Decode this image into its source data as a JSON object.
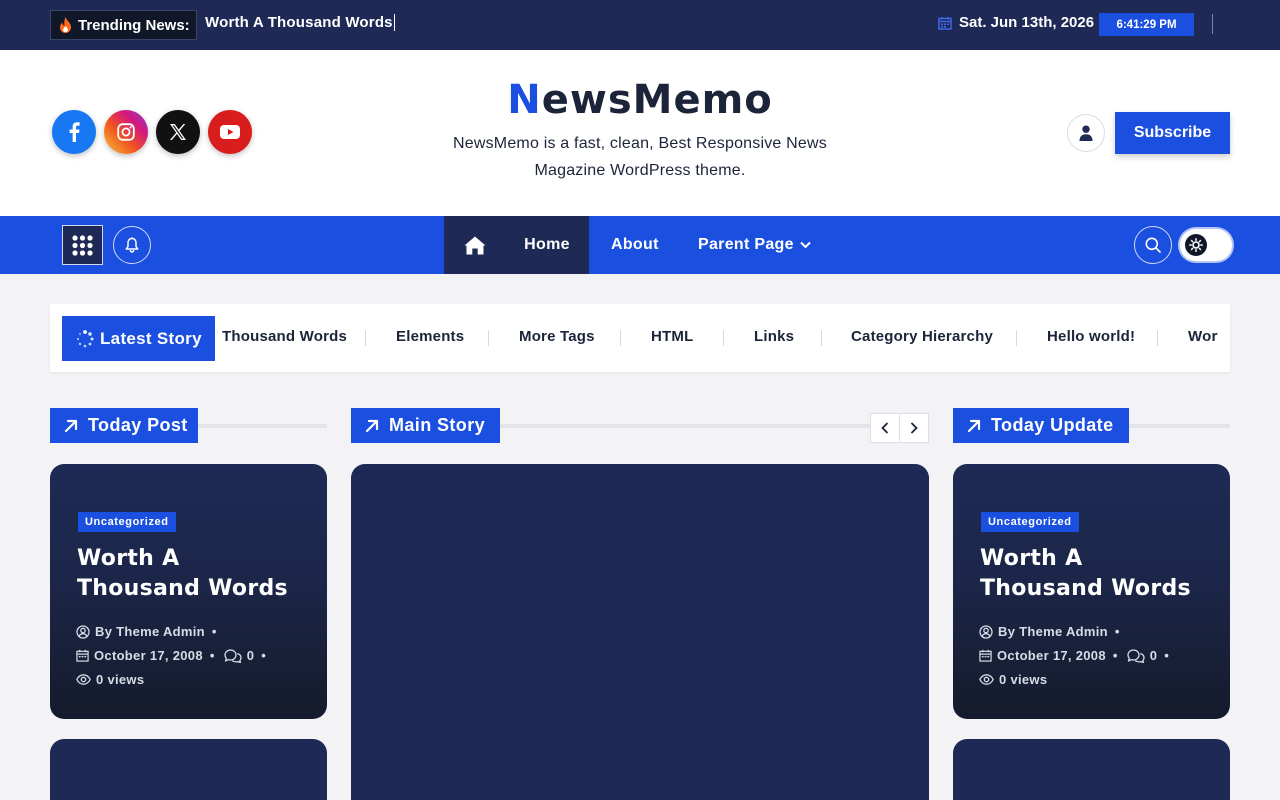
{
  "topbar": {
    "trending_label": "Trending News:",
    "trending_text": "Worth A Thousand Words",
    "date": "Sat. Jun 13th, 2026",
    "time": "6:41:29 PM"
  },
  "header": {
    "logo_first": "N",
    "logo_rest": "ewsMemo",
    "tagline": "NewsMemo is a fast, clean, Best Responsive News Magazine WordPress theme.",
    "subscribe_label": "Subscribe",
    "social": [
      "facebook-icon",
      "instagram-icon",
      "x-icon",
      "youtube-icon"
    ]
  },
  "nav": {
    "items": [
      {
        "label": "Home"
      },
      {
        "label": "About"
      },
      {
        "label": "Parent Page"
      }
    ]
  },
  "latest": {
    "label": "Latest Story",
    "items": [
      "Thousand Words",
      "Elements",
      "More Tags",
      "HTML",
      "Links",
      "Category Hierarchy",
      "Hello world!",
      "Wort"
    ]
  },
  "sections": {
    "today_post": "Today Post",
    "main_story": "Main Story",
    "today_update": "Today Update"
  },
  "cards": [
    {
      "category": "Uncategorized",
      "title": "Worth A Thousand Words",
      "author": "By Theme Admin",
      "date": "October 17, 2008",
      "comments": "0",
      "views": "0 views"
    },
    {
      "category": "Uncategorized",
      "title": "Worth A Thousand Words",
      "author": "By Theme Admin",
      "date": "October 17, 2008",
      "comments": "0",
      "views": "0 views"
    }
  ],
  "colors": {
    "navy": "#1e2a55",
    "accent": "#1a4fe0",
    "dark": "#101728"
  }
}
